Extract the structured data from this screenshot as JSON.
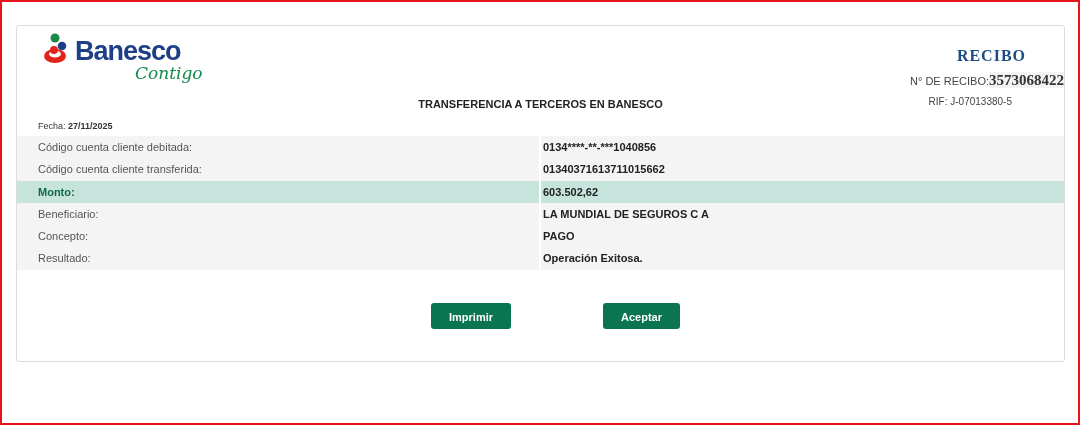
{
  "logo": {
    "name": "Banesco",
    "tagline": "Contigo"
  },
  "receipt": {
    "title": "RECIBO",
    "number_label": "N° DE RECIBO:",
    "number": "3573068422",
    "rif": "RIF: J-07013380-5"
  },
  "heading": "TRANSFERENCIA A TERCEROS EN BANESCO",
  "date": {
    "label": "Fecha:",
    "value": "27/11/2025"
  },
  "rows": [
    {
      "label": "Código cuenta cliente debitada:",
      "value": "0134****-**-***1040856",
      "highlighted": false
    },
    {
      "label": "Código cuenta cliente transferida:",
      "value": "01340371613711015662",
      "highlighted": false
    },
    {
      "label": "Monto:",
      "value": "603.502,62",
      "highlighted": true
    },
    {
      "label": "Beneficiario:",
      "value": "LA MUNDIAL DE SEGUROS C A",
      "highlighted": false
    },
    {
      "label": "Concepto:",
      "value": "PAGO",
      "highlighted": false
    },
    {
      "label": "Resultado:",
      "value": "Operación Exitosa.",
      "highlighted": false
    }
  ],
  "buttons": [
    {
      "label": "Imprimir"
    },
    {
      "label": "Aceptar"
    }
  ]
}
